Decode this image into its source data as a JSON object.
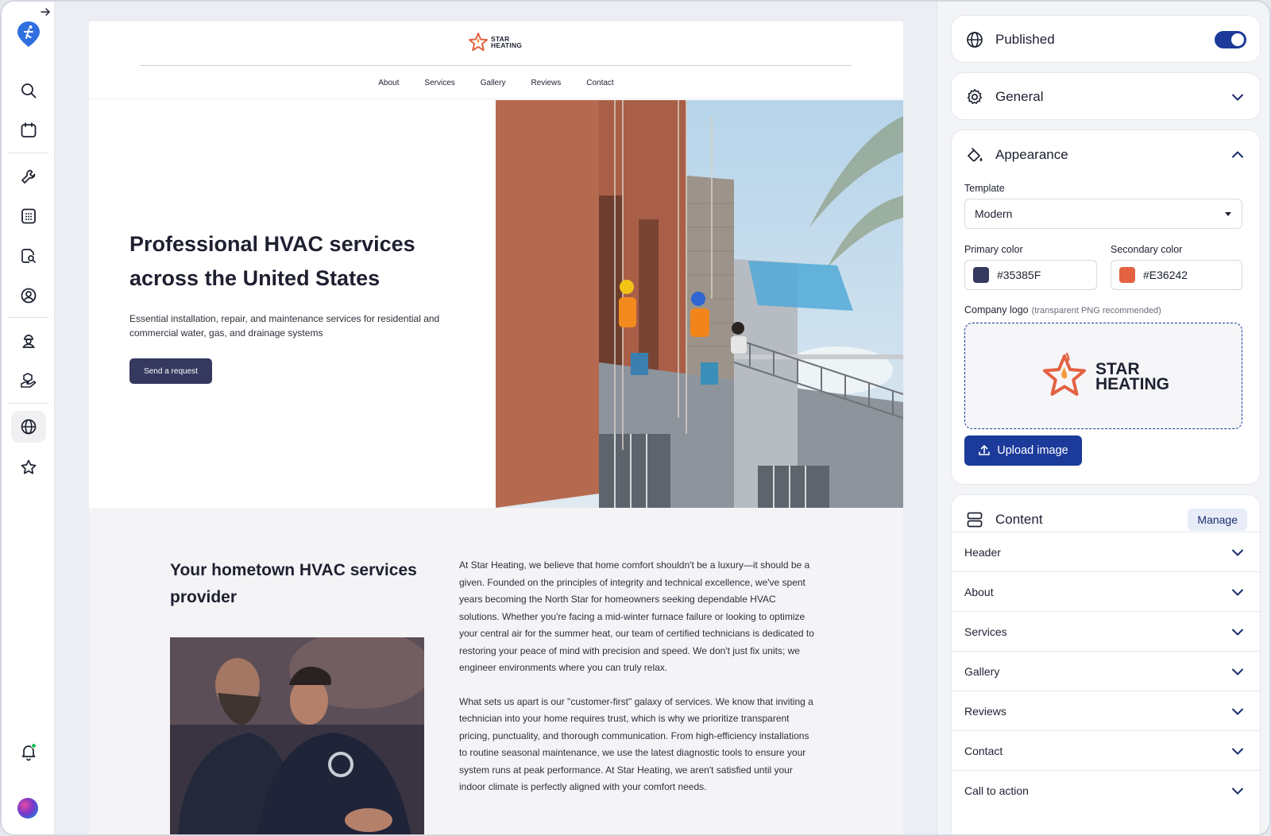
{
  "site": {
    "brand_line1": "STAR",
    "brand_line2": "HEATING",
    "nav": [
      "About",
      "Services",
      "Gallery",
      "Reviews",
      "Contact"
    ],
    "hero_title": "Professional HVAC services across the United States",
    "hero_text": "Essential installation, repair, and maintenance services for residential and commercial water, gas, and drainage systems",
    "hero_button": "Send a request",
    "about_title": "Your hometown HVAC services provider",
    "about_p1": "At Star Heating, we believe that home comfort shouldn't be a luxury—it should be a given. Founded on the principles of integrity and technical excellence, we've spent years becoming the North Star for homeowners seeking dependable HVAC solutions. Whether you're facing a mid-winter furnace failure or looking to optimize your central air for the summer heat, our team of certified technicians is dedicated to restoring your peace of mind with precision and speed. We don't just fix units; we engineer environments where you can truly relax.",
    "about_p2": "What sets us apart is our \"customer-first\" galaxy of services. We know that inviting a technician into your home requires trust, which is why we prioritize transparent pricing, punctuality, and thorough communication. From high-efficiency installations to routine seasonal maintenance, we use the latest diagnostic tools to ensure your system runs at peak performance. At Star Heating, we aren't satisfied until your indoor climate is perfectly aligned with your comfort needs."
  },
  "panel": {
    "published": {
      "label": "Published",
      "on": true
    },
    "general": {
      "label": "General"
    },
    "appearance": {
      "label": "Appearance",
      "template_label": "Template",
      "template_value": "Modern",
      "primary_label": "Primary color",
      "primary_value": "#35385F",
      "secondary_label": "Secondary color",
      "secondary_value": "#E36242",
      "logo_label": "Company logo",
      "logo_hint": "(transparent PNG recommended)",
      "upload_label": "Upload image"
    },
    "content": {
      "label": "Content",
      "manage_label": "Manage",
      "sections": [
        "Header",
        "About",
        "Services",
        "Gallery",
        "Reviews",
        "Contact",
        "Call to action"
      ]
    }
  },
  "colors": {
    "accent": "#1B3A9A",
    "primary": "#35385F",
    "secondary": "#E36242",
    "notification_dot": "#20C05C"
  },
  "rail_icons": [
    "search-icon",
    "calendar-icon",
    "wrench-icon",
    "calculator-icon",
    "document-search-icon",
    "user-circle-icon",
    "technician-icon",
    "package-hand-icon",
    "globe-icon",
    "star-icon",
    "bell-icon"
  ]
}
